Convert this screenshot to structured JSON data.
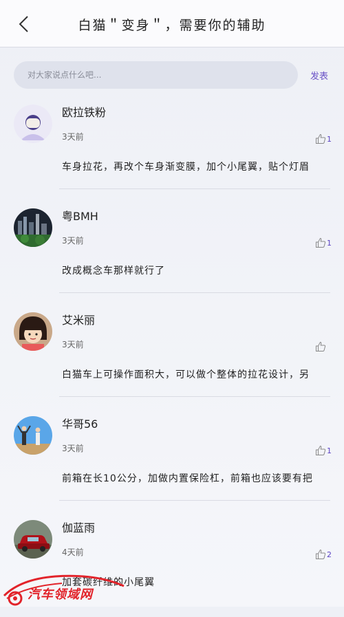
{
  "header": {
    "title": "白猫＂变身＂，需要你的辅助",
    "back_icon": "chevron-left-icon"
  },
  "composer": {
    "placeholder": "对大家说点什么吧...",
    "submit_label": "发表"
  },
  "comments": [
    {
      "user": "欧拉铁粉",
      "time": "3天前",
      "likes": "1",
      "text": "车身拉花，再改个车身渐变膜，加个小尾翼，贴个灯眉"
    },
    {
      "user": "粤BMH",
      "time": "3天前",
      "likes": "1",
      "text": "改成概念车那样就行了"
    },
    {
      "user": "艾米丽",
      "time": "3天前",
      "likes": "",
      "text": "白猫车上可操作面积大，可以做个整体的拉花设计，另"
    },
    {
      "user": "华哥56",
      "time": "3天前",
      "likes": "1",
      "text": "前箱在长10公分，加做内置保险杠，前箱也应该要有把"
    },
    {
      "user": "伽蓝雨",
      "time": "4天前",
      "likes": "2",
      "text": "加套碳纤维的小尾翼"
    }
  ],
  "watermark": {
    "text": "汽车领域网"
  },
  "colors": {
    "accent": "#5b43c4",
    "divider": "#d9dbe3",
    "watermark": "#e2232a"
  }
}
